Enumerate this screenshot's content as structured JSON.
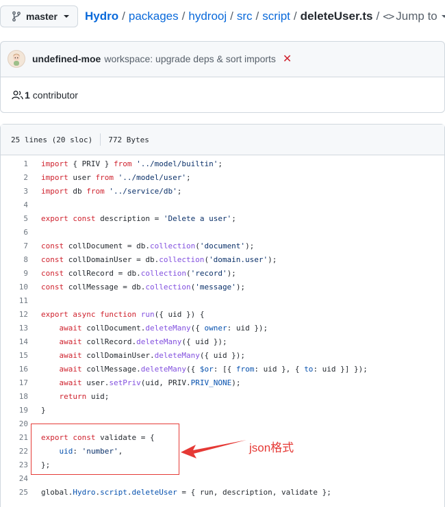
{
  "header": {
    "branch_label": "master",
    "breadcrumb": [
      "Hydro",
      "packages",
      "hydrooj",
      "src",
      "script"
    ],
    "file_name": "deleteUser.ts",
    "jump_label": "Jump to"
  },
  "commit": {
    "author": "undefined-moe",
    "message": "workspace: upgrade deps & sort imports",
    "status": "✕"
  },
  "contributors": {
    "count": "1",
    "label": "contributor"
  },
  "file_info": {
    "lines": "25 lines (20 sloc)",
    "size": "772 Bytes"
  },
  "code_lines": [
    [
      [
        "kw",
        "import"
      ],
      [
        "pn",
        " { PRIV } "
      ],
      [
        "kw",
        "from"
      ],
      [
        "pn",
        " "
      ],
      [
        "str",
        "'../model/builtin'"
      ],
      [
        "pn",
        ";"
      ]
    ],
    [
      [
        "kw",
        "import"
      ],
      [
        "pn",
        " user "
      ],
      [
        "kw",
        "from"
      ],
      [
        "pn",
        " "
      ],
      [
        "str",
        "'../model/user'"
      ],
      [
        "pn",
        ";"
      ]
    ],
    [
      [
        "kw",
        "import"
      ],
      [
        "pn",
        " db "
      ],
      [
        "kw",
        "from"
      ],
      [
        "pn",
        " "
      ],
      [
        "str",
        "'../service/db'"
      ],
      [
        "pn",
        ";"
      ]
    ],
    [],
    [
      [
        "kw",
        "export"
      ],
      [
        "pn",
        " "
      ],
      [
        "kw",
        "const"
      ],
      [
        "pn",
        " description = "
      ],
      [
        "str",
        "'Delete a user'"
      ],
      [
        "pn",
        ";"
      ]
    ],
    [],
    [
      [
        "kw",
        "const"
      ],
      [
        "pn",
        " collDocument = db."
      ],
      [
        "fn",
        "collection"
      ],
      [
        "pn",
        "("
      ],
      [
        "str",
        "'document'"
      ],
      [
        "pn",
        ");"
      ]
    ],
    [
      [
        "kw",
        "const"
      ],
      [
        "pn",
        " collDomainUser = db."
      ],
      [
        "fn",
        "collection"
      ],
      [
        "pn",
        "("
      ],
      [
        "str",
        "'domain.user'"
      ],
      [
        "pn",
        ");"
      ]
    ],
    [
      [
        "kw",
        "const"
      ],
      [
        "pn",
        " collRecord = db."
      ],
      [
        "fn",
        "collection"
      ],
      [
        "pn",
        "("
      ],
      [
        "str",
        "'record'"
      ],
      [
        "pn",
        ");"
      ]
    ],
    [
      [
        "kw",
        "const"
      ],
      [
        "pn",
        " collMessage = db."
      ],
      [
        "fn",
        "collection"
      ],
      [
        "pn",
        "("
      ],
      [
        "str",
        "'message'"
      ],
      [
        "pn",
        ");"
      ]
    ],
    [],
    [
      [
        "kw",
        "export"
      ],
      [
        "pn",
        " "
      ],
      [
        "kw",
        "async"
      ],
      [
        "pn",
        " "
      ],
      [
        "kw",
        "function"
      ],
      [
        "pn",
        " "
      ],
      [
        "fn",
        "run"
      ],
      [
        "pn",
        "({ uid }) {"
      ]
    ],
    [
      [
        "pn",
        "    "
      ],
      [
        "kw",
        "await"
      ],
      [
        "pn",
        " collDocument."
      ],
      [
        "fn",
        "deleteMany"
      ],
      [
        "pn",
        "({ "
      ],
      [
        "prop",
        "owner"
      ],
      [
        "pn",
        ": uid });"
      ]
    ],
    [
      [
        "pn",
        "    "
      ],
      [
        "kw",
        "await"
      ],
      [
        "pn",
        " collRecord."
      ],
      [
        "fn",
        "deleteMany"
      ],
      [
        "pn",
        "({ uid });"
      ]
    ],
    [
      [
        "pn",
        "    "
      ],
      [
        "kw",
        "await"
      ],
      [
        "pn",
        " collDomainUser."
      ],
      [
        "fn",
        "deleteMany"
      ],
      [
        "pn",
        "({ uid });"
      ]
    ],
    [
      [
        "pn",
        "    "
      ],
      [
        "kw",
        "await"
      ],
      [
        "pn",
        " collMessage."
      ],
      [
        "fn",
        "deleteMany"
      ],
      [
        "pn",
        "({ "
      ],
      [
        "prop",
        "$or"
      ],
      [
        "pn",
        ": [{ "
      ],
      [
        "prop",
        "from"
      ],
      [
        "pn",
        ": uid }, { "
      ],
      [
        "prop",
        "to"
      ],
      [
        "pn",
        ": uid }] });"
      ]
    ],
    [
      [
        "pn",
        "    "
      ],
      [
        "kw",
        "await"
      ],
      [
        "pn",
        " user."
      ],
      [
        "fn",
        "setPriv"
      ],
      [
        "pn",
        "(uid, PRIV."
      ],
      [
        "prop",
        "PRIV_NONE"
      ],
      [
        "pn",
        ");"
      ]
    ],
    [
      [
        "pn",
        "    "
      ],
      [
        "kw",
        "return"
      ],
      [
        "pn",
        " uid;"
      ]
    ],
    [
      [
        "pn",
        "}"
      ]
    ],
    [],
    [
      [
        "kw",
        "export"
      ],
      [
        "pn",
        " "
      ],
      [
        "kw",
        "const"
      ],
      [
        "pn",
        " validate = {"
      ]
    ],
    [
      [
        "pn",
        "    "
      ],
      [
        "prop",
        "uid"
      ],
      [
        "pn",
        ": "
      ],
      [
        "str",
        "'number'"
      ],
      [
        "pn",
        ","
      ]
    ],
    [
      [
        "pn",
        "};"
      ]
    ],
    [],
    [
      [
        "pn",
        "global."
      ],
      [
        "prop",
        "Hydro"
      ],
      [
        "pn",
        "."
      ],
      [
        "prop",
        "script"
      ],
      [
        "pn",
        "."
      ],
      [
        "prop",
        "deleteUser"
      ],
      [
        "pn",
        " = { run, description, validate };"
      ]
    ]
  ],
  "annotation": {
    "label": "json格式",
    "color": "#e53935"
  },
  "colors": {
    "link": "#0969da",
    "keyword": "#cf222e",
    "string": "#0a3069",
    "function": "#8250df",
    "property": "#0550ae"
  }
}
